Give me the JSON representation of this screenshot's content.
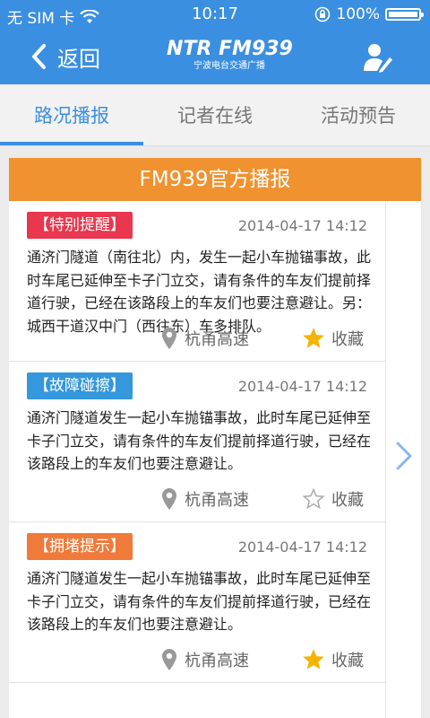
{
  "status_bar": {
    "carrier": "无 SIM 卡",
    "time": "10:17",
    "battery": "100%",
    "battery_level": 1.0,
    "icons": [
      "wifi-icon",
      "orientation-lock-icon",
      "battery-icon"
    ]
  },
  "navbar": {
    "back_label": "返回",
    "logo_main": "NTR FM939",
    "logo_sub": "宁波电台交通广播",
    "icons": [
      "chevron-left-icon",
      "user-edit-icon"
    ]
  },
  "tabs": [
    {
      "label": "路况播报",
      "active": true
    },
    {
      "label": "记者在线",
      "active": false
    },
    {
      "label": "活动预告",
      "active": false
    }
  ],
  "card": {
    "title": "FM939官方播报",
    "items": [
      {
        "tag": "【特别提醒】",
        "tag_color": "#e8374e",
        "date": "2014-04-17  14:12",
        "content": "通济门隧道（南往北）内，发生一起小车抛锚事故，此时车尾已延伸至卡子门立交，请有条件的车友们提前择道行驶，已经在该路段上的车友们也要注意避让。另：城西干道汉中门（西往东）车多排队。",
        "location": "杭甬高速",
        "fav_label": "收藏",
        "favorited": true
      },
      {
        "tag": "【故障碰擦】",
        "tag_color": "#3597dc",
        "date": "2014-04-17  14:12",
        "content": "通济门隧道发生一起小车抛锚事故，此时车尾已延伸至卡子门立交，请有条件的车友们提前择道行驶，已经在该路段上的车友们也要注意避让。",
        "location": "杭甬高速",
        "fav_label": "收藏",
        "favorited": false
      },
      {
        "tag": "【拥堵提示】",
        "tag_color": "#f07a3a",
        "date": "2014-04-17  14:12",
        "content": "通济门隧道发生一起小车抛锚事故，此时车尾已延伸至卡子门立交，请有条件的车友们提前择道行驶，已经在该路段上的车友们也要注意避让。",
        "location": "杭甬高速",
        "fav_label": "收藏",
        "favorited": true
      }
    ]
  },
  "colors": {
    "primary": "#3b8fe0",
    "header_orange": "#f0922f",
    "star_gold": "#f4b400",
    "star_empty": "#aaaaaa"
  }
}
